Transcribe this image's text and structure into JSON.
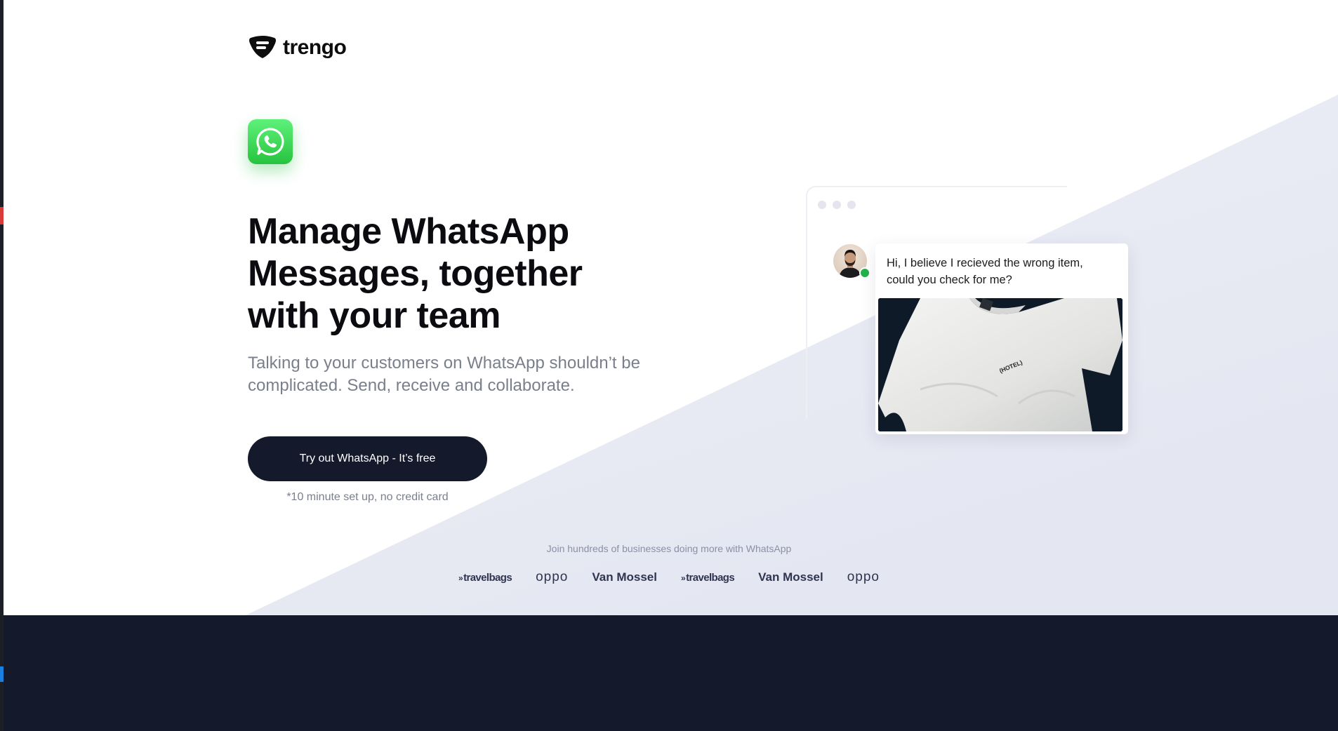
{
  "header": {
    "logo_text": "trengo"
  },
  "hero": {
    "icon": "whatsapp-icon",
    "headline": "Manage WhatsApp Messages, together with your team",
    "subtitle": "Talking to your customers on WhatsApp shouldn’t be complicated. Send, receive and collaborate.",
    "cta_label": "Try out WhatsApp - It’s free",
    "cta_note": "*10 minute set up, no credit card"
  },
  "chat": {
    "message": "Hi, I believe I recieved the wrong item, could you check for me?",
    "image_label": "(HOTEL)"
  },
  "social_proof": {
    "text": "Join hundreds of businesses doing more with WhatsApp",
    "brands": [
      "travelbags",
      "oppo",
      "Van Mossel",
      "travelbags",
      "Van Mossel",
      "oppo"
    ]
  },
  "colors": {
    "dark": "#141a2c",
    "whatsapp_green": "#27c33f",
    "muted_text": "#7a7f8c",
    "hero_shape": "#e4e6f1"
  }
}
